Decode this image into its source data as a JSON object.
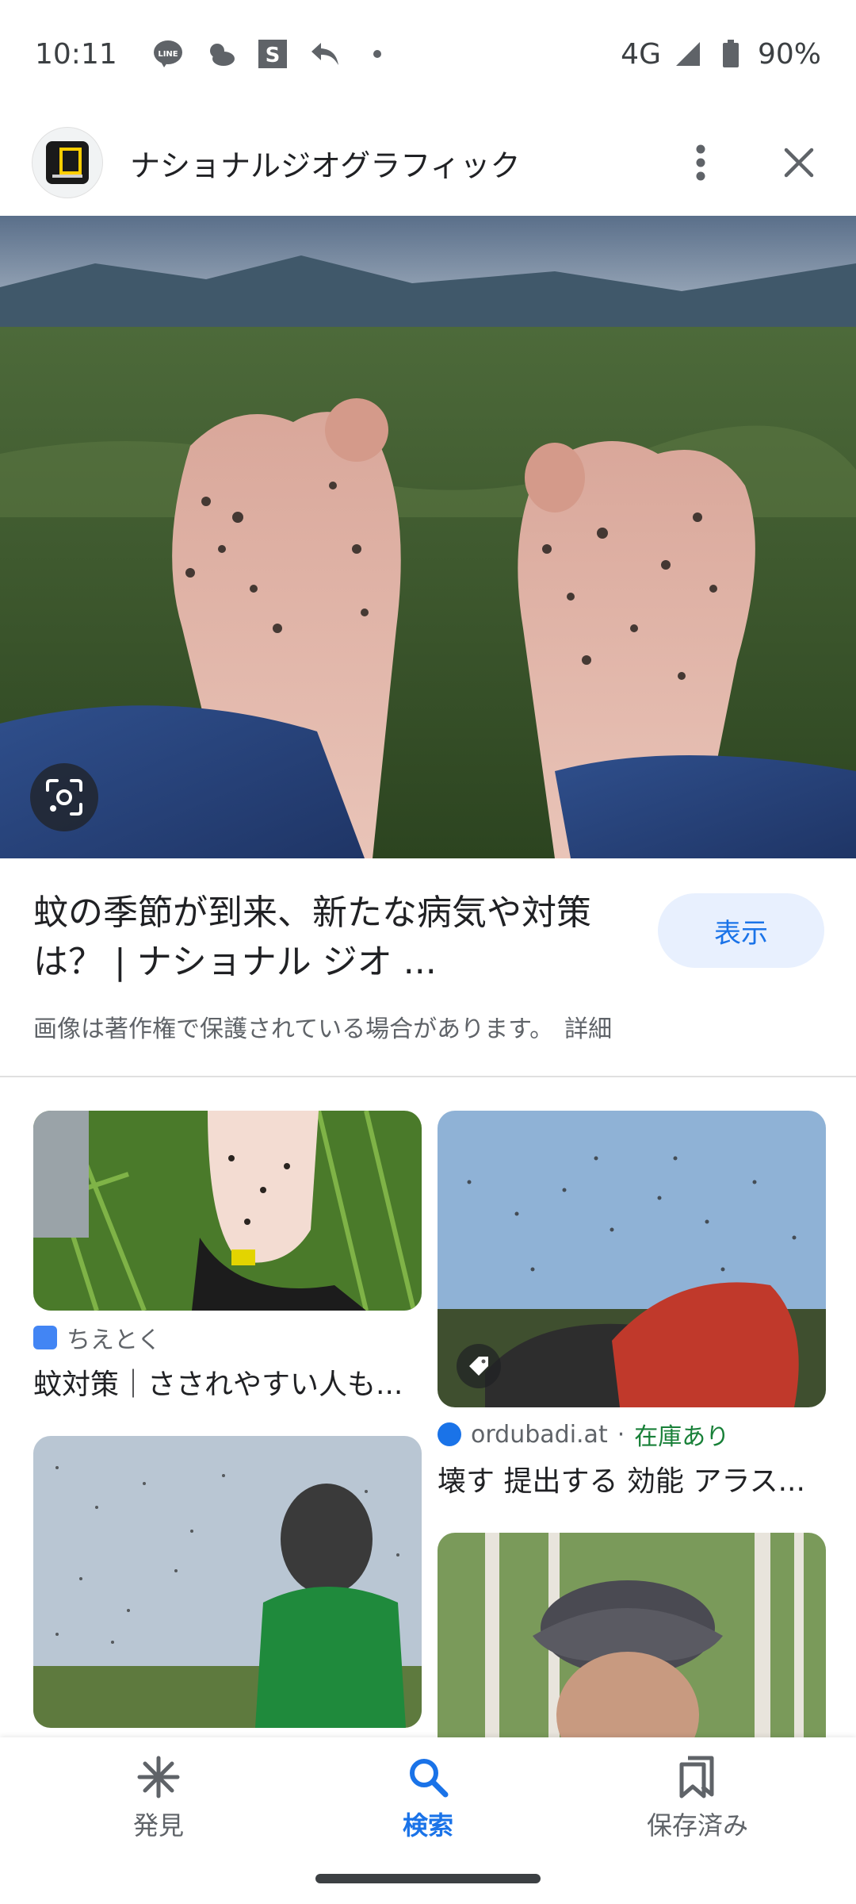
{
  "status_bar": {
    "time": "10:11",
    "network": "4G",
    "battery": "90%",
    "icons": [
      "line-icon",
      "weather-icon",
      "s-app-icon",
      "reply-icon",
      "dot-icon",
      "signal-icon",
      "battery-icon"
    ]
  },
  "header": {
    "site_name": "ナショナルジオグラフィック",
    "actions": [
      "more-vert-icon",
      "close-icon"
    ]
  },
  "main_result": {
    "title": "蚊の季節が到来、新たな病気や対策は？ | ナショナル ジオ ...",
    "visit_label": "表示",
    "copyright_notice": "画像は著作権で保護されている場合があります。",
    "details_label": "詳細"
  },
  "related": {
    "left": [
      {
        "source": "ちえとく",
        "title": "蚊対策｜さされやすい人も..."
      },
      {
        "source": "",
        "title": ""
      }
    ],
    "right": [
      {
        "source": "ordubadi.at",
        "stock": "在庫あり",
        "title": "壊す 提出する 効能 アラス..."
      },
      {
        "source": "",
        "title": ""
      }
    ]
  },
  "bottom_nav": {
    "items": [
      {
        "label": "発見",
        "icon": "asterisk-icon",
        "active": false
      },
      {
        "label": "検索",
        "icon": "search-icon",
        "active": true
      },
      {
        "label": "保存済み",
        "icon": "bookmarks-icon",
        "active": false
      }
    ]
  },
  "colors": {
    "accent": "#1a73e8",
    "in_stock": "#188038",
    "visit_button_bg": "#e8f0fe"
  }
}
